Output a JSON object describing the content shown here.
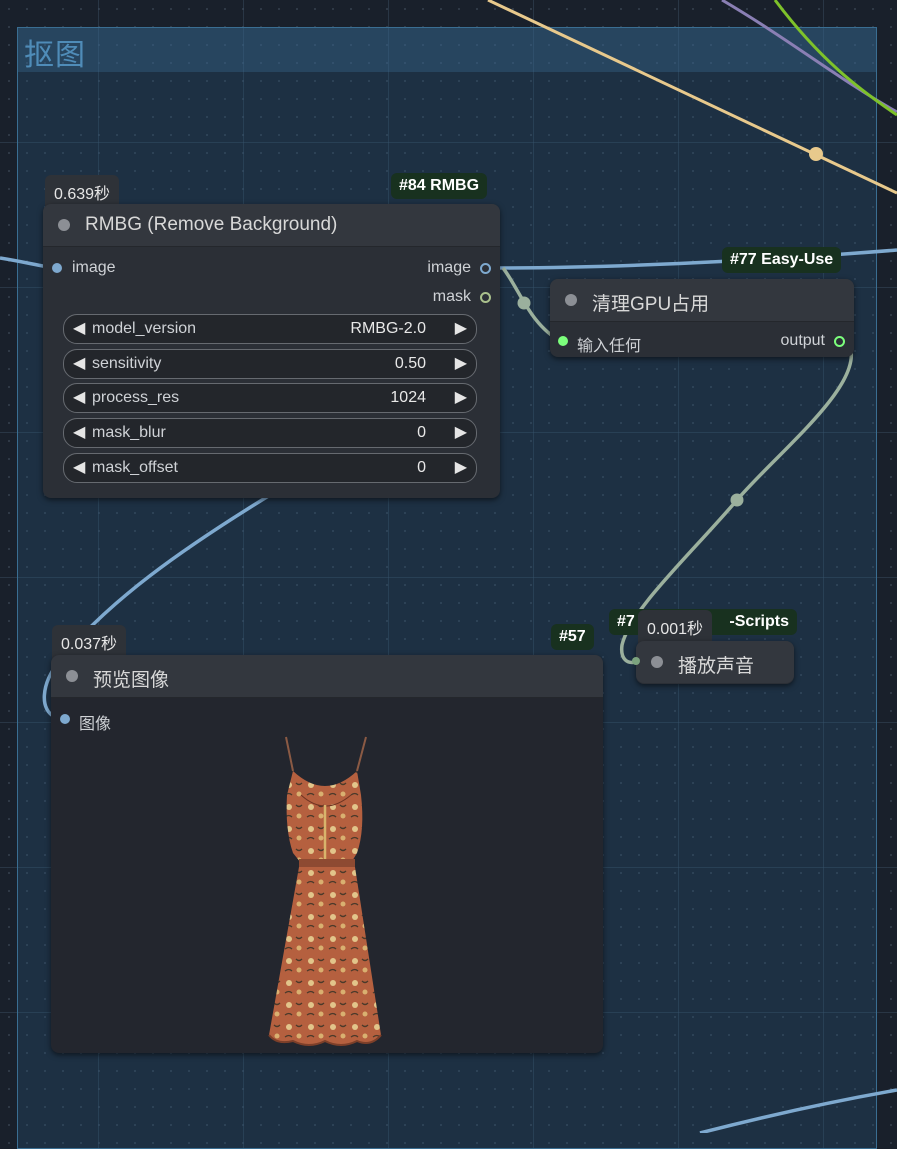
{
  "group": {
    "title": "抠图"
  },
  "nodes": {
    "rmbg": {
      "time": "0.639秒",
      "badge": "#84 RMBG",
      "title": "RMBG (Remove Background)",
      "input_image": "image",
      "output_image": "image",
      "output_mask": "mask",
      "widgets": [
        {
          "name": "model_version",
          "value": "RMBG-2.0"
        },
        {
          "name": "sensitivity",
          "value": "0.50"
        },
        {
          "name": "process_res",
          "value": "1024"
        },
        {
          "name": "mask_blur",
          "value": "0"
        },
        {
          "name": "mask_offset",
          "value": "0"
        }
      ]
    },
    "gpu": {
      "badge": "#77 Easy-Use",
      "title": "清理GPU占用",
      "input": "输入任何",
      "output": "output"
    },
    "preview": {
      "time": "0.037秒",
      "badge": "#57",
      "title": "预览图像",
      "input": "图像"
    },
    "sound": {
      "badge_left": "#7",
      "badge_right": "-Scripts",
      "time": "0.001秒",
      "title": "播放声音"
    }
  },
  "colors": {
    "image_wire": "#7ea9cf",
    "any_wire": "#9bb09d",
    "yellow_wire": "#e8c98c",
    "purple_wire": "#8a7fb4",
    "green_wire": "#7ec22a",
    "output_dot": "#7cff7c",
    "mask_dot": "#a9c08c",
    "badge_bg": "#18311f"
  }
}
